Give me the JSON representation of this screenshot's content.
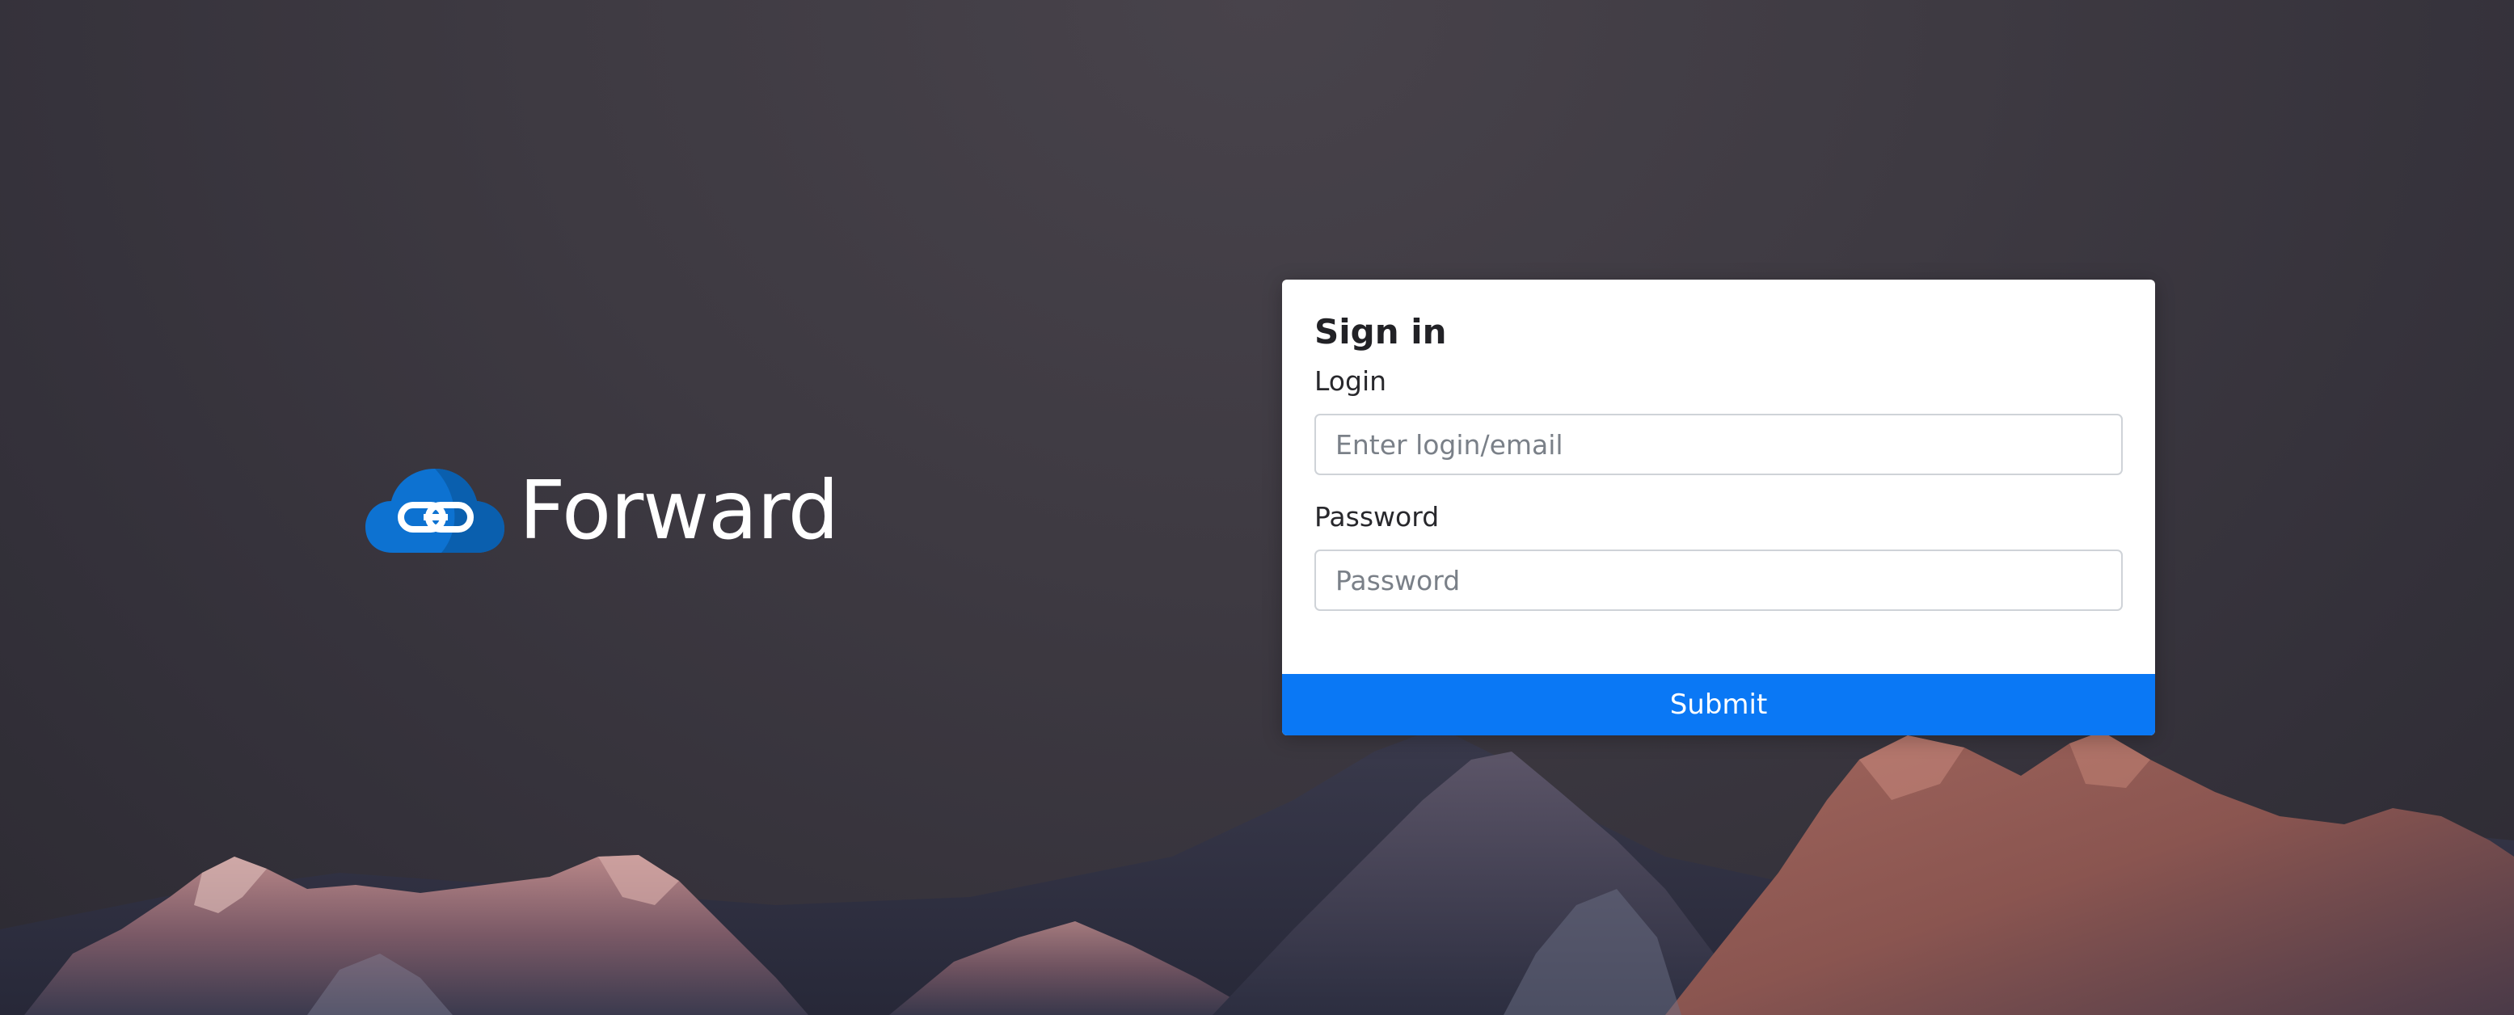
{
  "brand": {
    "name": "Forward",
    "logo_icon": "cloud-link-icon",
    "logo_color": "#0b6fcf"
  },
  "signin": {
    "title": "Sign in",
    "login_label": "Login",
    "login_placeholder": "Enter login/email",
    "login_value": "",
    "password_label": "Password",
    "password_placeholder": "Password",
    "password_value": "",
    "submit_label": "Submit",
    "accent_color": "#0a78f5"
  }
}
